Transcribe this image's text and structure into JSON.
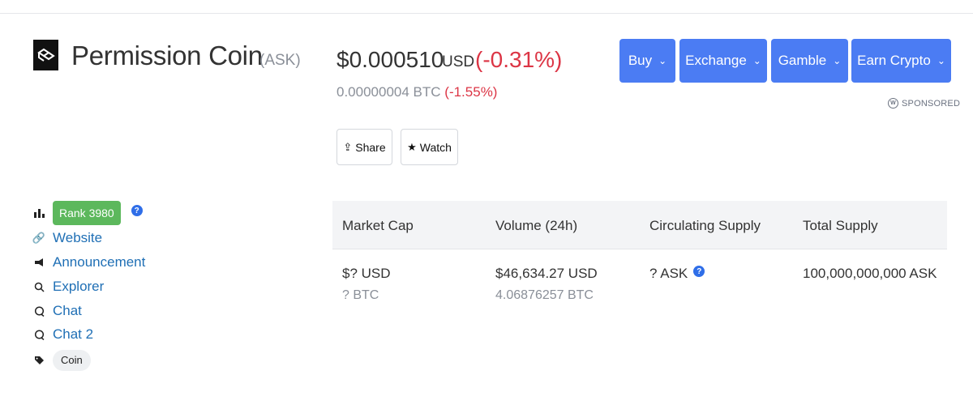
{
  "coin": {
    "name": "Permission Coin",
    "symbol": "(ASK)"
  },
  "price": {
    "usd": "$0.000510",
    "usd_currency": "USD",
    "usd_change": "(-0.31%)",
    "btc": "0.00000004 BTC",
    "btc_change": "(-1.55%)"
  },
  "actions": {
    "share_label": "Share",
    "watch_label": "Watch"
  },
  "menu_buttons": [
    {
      "label": "Buy"
    },
    {
      "label": "Exchange"
    },
    {
      "label": "Gamble"
    },
    {
      "label": "Earn Crypto"
    }
  ],
  "sponsored_label": "SPONSORED",
  "sidebar": {
    "rank": "Rank 3980",
    "help_glyph": "?",
    "links": [
      {
        "label": "Website",
        "icon": "link-icon"
      },
      {
        "label": "Announcement",
        "icon": "megaphone-icon"
      },
      {
        "label": "Explorer",
        "icon": "search-icon"
      },
      {
        "label": "Chat",
        "icon": "chat-icon"
      },
      {
        "label": "Chat 2",
        "icon": "chat-icon"
      }
    ],
    "tag": "Coin"
  },
  "stats": {
    "headers": [
      "Market Cap",
      "Volume (24h)",
      "Circulating Supply",
      "Total Supply"
    ],
    "primary": [
      "$? USD",
      "$46,634.27 USD",
      "? ASK",
      "100,000,000,000 ASK"
    ],
    "secondary": [
      "? BTC",
      "4.06876257 BTC",
      "",
      ""
    ]
  },
  "colors": {
    "accent_blue": "#4b7cf3",
    "negative_red": "#dc3545",
    "rank_green": "#5cb85c",
    "link_blue": "#1f6fb5"
  }
}
